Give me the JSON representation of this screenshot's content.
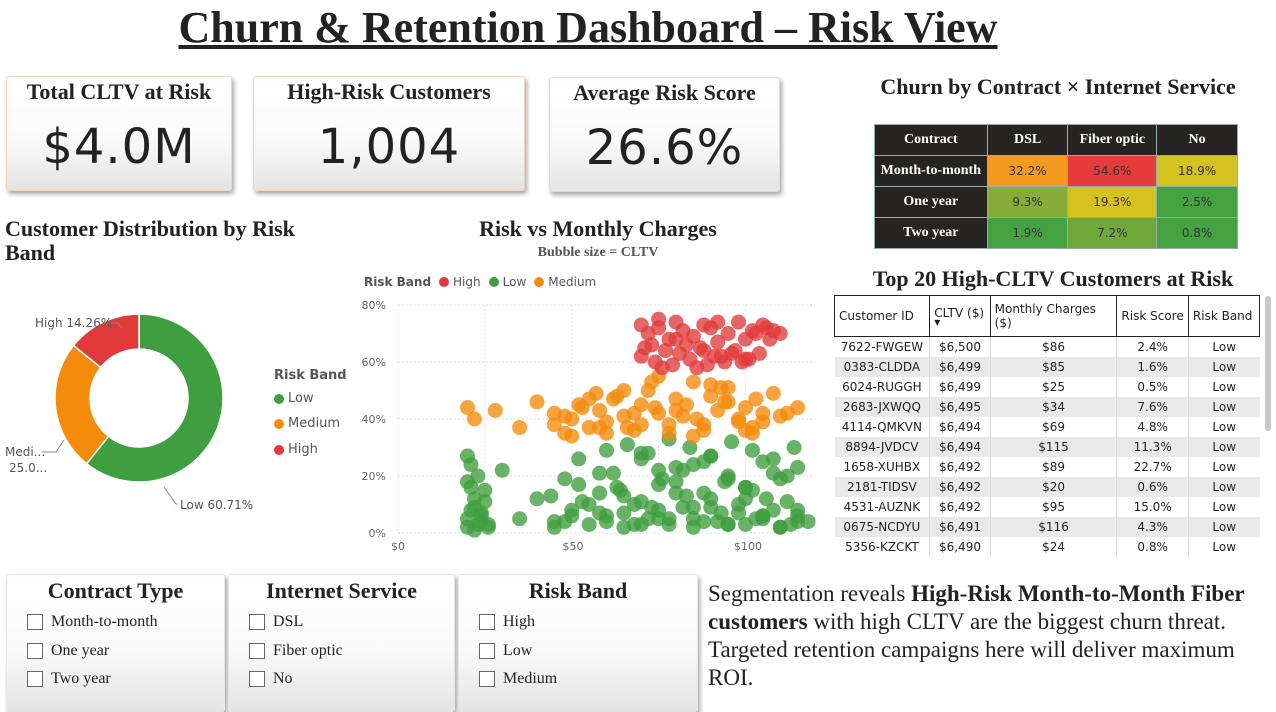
{
  "title": "Churn & Retention Dashboard – Risk View",
  "kpis": [
    {
      "label": "Total CLTV at Risk",
      "value": "$4.0M"
    },
    {
      "label": "High-Risk Customers",
      "value": "1,004"
    },
    {
      "label": "Average Risk Score",
      "value": "26.6%"
    }
  ],
  "colors": {
    "high": "#e03a3a",
    "medium": "#f58b0a",
    "low": "#3f9e3f"
  },
  "matrix": {
    "title": "Churn by Contract × Internet Service",
    "columns": [
      "Contract",
      "DSL",
      "Fiber optic",
      "No"
    ],
    "rows": [
      {
        "label": "Month-to-month",
        "values": [
          "32.2%",
          "54.6%",
          "18.9%"
        ],
        "colors": [
          "#f59a1e",
          "#e53b3b",
          "#d4c221"
        ]
      },
      {
        "label": "One year",
        "values": [
          "9.3%",
          "19.3%",
          "2.5%"
        ],
        "colors": [
          "#88ac3a",
          "#d4c221",
          "#44a240"
        ]
      },
      {
        "label": "Two year",
        "values": [
          "1.9%",
          "7.2%",
          "0.8%"
        ],
        "colors": [
          "#44a240",
          "#6fa93a",
          "#44a240"
        ]
      }
    ]
  },
  "donut": {
    "title": "Customer Distribution by Risk Band",
    "legend_title": "Risk Band",
    "legend": [
      "Low",
      "Medium",
      "High"
    ],
    "labels": {
      "high": "High 14.26%",
      "medium_1": "Medi...",
      "medium_2": "25.0...",
      "low": "Low 60.71%"
    }
  },
  "scatter": {
    "title": "Risk vs Monthly Charges",
    "subtitle": "Bubble size = CLTV",
    "legend_title": "Risk Band",
    "legend": [
      "High",
      "Low",
      "Medium"
    ],
    "y_ticks": [
      "80%",
      "60%",
      "40%",
      "20%",
      "0%"
    ],
    "x_ticks": [
      "$0",
      "$50",
      "$100"
    ]
  },
  "chart_data": [
    {
      "type": "pie",
      "title": "Customer Distribution by Risk Band",
      "categories": [
        "Low",
        "Medium",
        "High"
      ],
      "values": [
        60.71,
        25.03,
        14.26
      ],
      "legend_title": "Risk Band",
      "legend_position": "right"
    },
    {
      "type": "scatter",
      "title": "Risk vs Monthly Charges",
      "subtitle": "Bubble size = CLTV",
      "ylim": [
        0,
        0.8
      ],
      "xlim": [
        0,
        120
      ],
      "legend_title": "Risk Band",
      "legend_position": "top-left",
      "series": [
        {
          "name": "High",
          "x": [
            70,
            72,
            75,
            78,
            80,
            82,
            85,
            88,
            90,
            92,
            95,
            98,
            100,
            102,
            105,
            110,
            70,
            74,
            77,
            81,
            84,
            87,
            91,
            94,
            97,
            101,
            104,
            108,
            73,
            79,
            86,
            93,
            99,
            106,
            75,
            83,
            89,
            96,
            103,
            71,
            76,
            80,
            88,
            92,
            100,
            107
          ],
          "y": [
            0.73,
            0.7,
            0.72,
            0.68,
            0.74,
            0.71,
            0.69,
            0.73,
            0.72,
            0.67,
            0.7,
            0.74,
            0.68,
            0.71,
            0.73,
            0.7,
            0.62,
            0.6,
            0.64,
            0.63,
            0.61,
            0.65,
            0.62,
            0.6,
            0.64,
            0.61,
            0.63,
            0.71,
            0.66,
            0.59,
            0.58,
            0.62,
            0.6,
            0.72,
            0.75,
            0.66,
            0.59,
            0.63,
            0.7,
            0.65,
            0.58,
            0.68,
            0.64,
            0.74,
            0.61,
            0.68
          ]
        },
        {
          "name": "Medium",
          "x": [
            20,
            22,
            28,
            35,
            40,
            45,
            48,
            50,
            52,
            55,
            58,
            60,
            62,
            65,
            68,
            70,
            72,
            75,
            78,
            80,
            82,
            85,
            88,
            90,
            92,
            95,
            98,
            100,
            102,
            105,
            108,
            110,
            115,
            55,
            60,
            65,
            70,
            75,
            80,
            85,
            90,
            95,
            100,
            105,
            48,
            53,
            58,
            63,
            68,
            73,
            78,
            83,
            88,
            93,
            98,
            103,
            45,
            50,
            57,
            66,
            74,
            86,
            94,
            102,
            112
          ],
          "y": [
            0.44,
            0.4,
            0.43,
            0.37,
            0.46,
            0.42,
            0.35,
            0.4,
            0.45,
            0.37,
            0.43,
            0.39,
            0.47,
            0.41,
            0.36,
            0.45,
            0.5,
            0.42,
            0.38,
            0.47,
            0.41,
            0.53,
            0.36,
            0.48,
            0.43,
            0.51,
            0.39,
            0.44,
            0.37,
            0.42,
            0.49,
            0.41,
            0.44,
            0.47,
            0.35,
            0.5,
            0.38,
            0.55,
            0.43,
            0.34,
            0.52,
            0.46,
            0.36,
            0.39,
            0.41,
            0.44,
            0.37,
            0.48,
            0.42,
            0.53,
            0.35,
            0.45,
            0.38,
            0.51,
            0.4,
            0.47,
            0.38,
            0.34,
            0.49,
            0.37,
            0.44,
            0.4,
            0.46,
            0.35,
            0.42
          ]
        },
        {
          "name": "Low",
          "x": [
            20,
            20,
            21,
            22,
            23,
            24,
            25,
            26,
            20,
            21,
            22,
            23,
            24,
            25,
            20,
            21,
            22,
            24,
            26,
            30,
            35,
            40,
            45,
            48,
            50,
            52,
            55,
            58,
            60,
            62,
            65,
            68,
            70,
            72,
            75,
            78,
            80,
            82,
            85,
            88,
            90,
            92,
            95,
            98,
            100,
            102,
            105,
            108,
            110,
            112,
            115,
            118,
            45,
            50,
            55,
            60,
            65,
            70,
            75,
            80,
            85,
            90,
            95,
            100,
            105,
            110,
            115,
            48,
            53,
            58,
            63,
            68,
            73,
            78,
            83,
            88,
            93,
            98,
            103,
            108,
            113,
            70,
            75,
            80,
            85,
            90,
            95,
            100,
            105,
            110,
            115,
            60,
            66,
            72,
            78,
            84,
            90,
            96,
            102,
            108,
            114,
            44,
            52,
            58,
            64,
            70,
            76,
            82,
            88,
            94,
            100,
            106,
            112,
            65,
            75,
            85,
            95,
            105,
            115
          ],
          "y": [
            0.02,
            0.05,
            0.08,
            0.12,
            0.03,
            0.06,
            0.15,
            0.02,
            0.18,
            0.24,
            0.09,
            0.2,
            0.04,
            0.11,
            0.27,
            0.16,
            0.01,
            0.07,
            0.03,
            0.22,
            0.05,
            0.12,
            0.04,
            0.19,
            0.08,
            0.26,
            0.03,
            0.14,
            0.06,
            0.21,
            0.02,
            0.1,
            0.28,
            0.05,
            0.17,
            0.03,
            0.23,
            0.09,
            0.02,
            0.25,
            0.12,
            0.04,
            0.19,
            0.07,
            0.03,
            0.15,
            0.05,
            0.21,
            0.02,
            0.11,
            0.06,
            0.04,
            0.02,
            0.06,
            0.1,
            0.04,
            0.13,
            0.03,
            0.08,
            0.14,
            0.05,
            0.09,
            0.03,
            0.12,
            0.06,
            0.02,
            0.08,
            0.04,
            0.11,
            0.07,
            0.16,
            0.03,
            0.09,
            0.05,
            0.13,
            0.04,
            0.07,
            0.1,
            0.05,
            0.08,
            0.03,
            0.26,
            0.22,
            0.18,
            0.24,
            0.27,
            0.2,
            0.16,
            0.25,
            0.19,
            0.23,
            0.29,
            0.31,
            0.28,
            0.33,
            0.3,
            0.27,
            0.32,
            0.29,
            0.26,
            0.3,
            0.13,
            0.17,
            0.21,
            0.15,
            0.11,
            0.19,
            0.22,
            0.14,
            0.18,
            0.16,
            0.12,
            0.2,
            0.07,
            0.05,
            0.09,
            0.03,
            0.06,
            0.04
          ]
        }
      ]
    },
    {
      "type": "heatmap",
      "title": "Churn by Contract × Internet Service",
      "x": [
        "DSL",
        "Fiber optic",
        "No"
      ],
      "y": [
        "Month-to-month",
        "One year",
        "Two year"
      ],
      "values": [
        [
          32.2,
          54.6,
          18.9
        ],
        [
          9.3,
          19.3,
          2.5
        ],
        [
          1.9,
          7.2,
          0.8
        ]
      ]
    }
  ],
  "top_table": {
    "title": "Top 20 High-CLTV Customers at Risk",
    "columns": [
      "Customer ID",
      "CLTV ($)",
      "Monthly Charges ($)",
      "Risk Score",
      "Risk Band"
    ],
    "rows": [
      [
        "7622-FWGEW",
        "$6,500",
        "$86",
        "2.4%",
        "Low"
      ],
      [
        "0383-CLDDA",
        "$6,499",
        "$85",
        "1.6%",
        "Low"
      ],
      [
        "6024-RUGGH",
        "$6,499",
        "$25",
        "0.5%",
        "Low"
      ],
      [
        "2683-JXWQQ",
        "$6,495",
        "$34",
        "7.6%",
        "Low"
      ],
      [
        "4114-QMKVN",
        "$6,494",
        "$69",
        "4.8%",
        "Low"
      ],
      [
        "8894-JVDCV",
        "$6,494",
        "$115",
        "11.3%",
        "Low"
      ],
      [
        "1658-XUHBX",
        "$6,492",
        "$89",
        "22.7%",
        "Low"
      ],
      [
        "2181-TIDSV",
        "$6,492",
        "$20",
        "0.6%",
        "Low"
      ],
      [
        "4531-AUZNK",
        "$6,492",
        "$95",
        "15.0%",
        "Low"
      ],
      [
        "0675-NCDYU",
        "$6,491",
        "$116",
        "4.3%",
        "Low"
      ],
      [
        "5356-KZCKT",
        "$6,490",
        "$24",
        "0.8%",
        "Low"
      ]
    ]
  },
  "slicers": [
    {
      "title": "Contract Type",
      "options": [
        "Month-to-month",
        "One year",
        "Two year"
      ]
    },
    {
      "title": "Internet Service",
      "options": [
        "DSL",
        "Fiber optic",
        "No"
      ]
    },
    {
      "title": "Risk Band",
      "options": [
        "High",
        "Low",
        "Medium"
      ]
    }
  ],
  "insight": {
    "pre": "Segmentation reveals ",
    "bold": "High-Risk Month-to-Month Fiber customers",
    "post": " with high CLTV are the biggest churn threat. Targeted retention campaigns here will deliver maximum ROI."
  }
}
